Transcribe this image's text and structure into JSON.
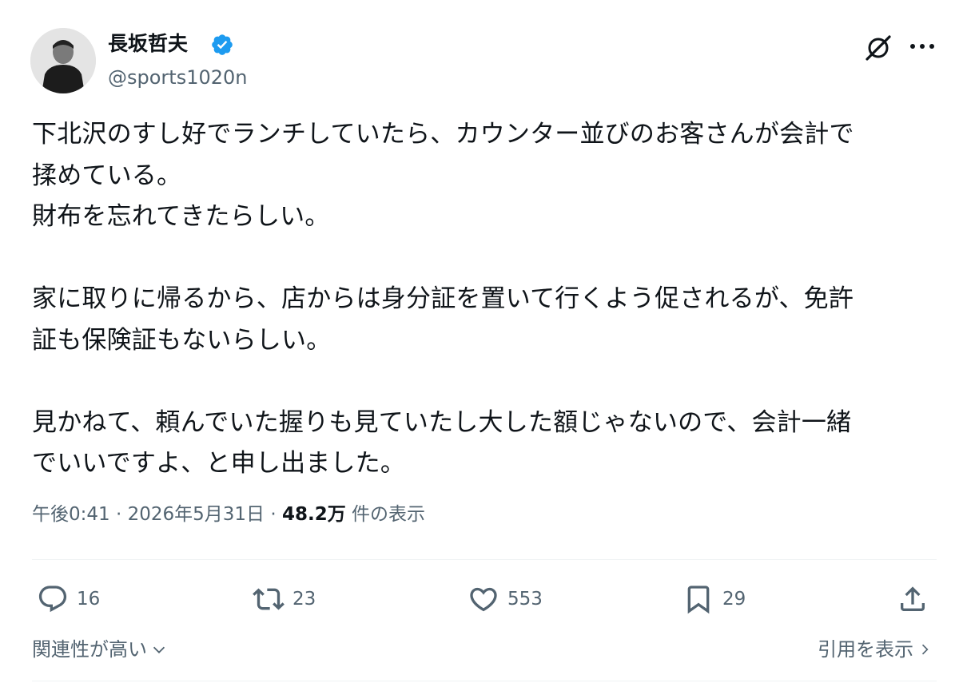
{
  "author": {
    "name": "長坂哲夫",
    "handle": "@sports1020n",
    "verified": true
  },
  "colors": {
    "verified_badge": "#1d9bf0",
    "text_primary": "#0f1419",
    "text_secondary": "#536471"
  },
  "tweet": {
    "text": "下北沢のすし好でランチしていたら、カウンター並びのお客さんが会計で\n揉めている。\n財布を忘れてきたらしい。\n\n家に取りに帰るから、店からは身分証を置いて行くよう促されるが、免許\n証も保険証もないらしい。\n\n見かねて、頼んでいた握りも見ていたし大した額じゃないので、会計一緒\nでいいですよ、と申し出ました。"
  },
  "meta": {
    "time": "午後0:41",
    "separator": "·",
    "date": "2026年5月31日",
    "views_count": "48.2万",
    "views_label": "件の表示"
  },
  "actions": {
    "replies": "16",
    "reposts": "23",
    "likes": "553",
    "bookmarks": "29"
  },
  "footer": {
    "sort_label": "関連性が高い",
    "quotes_label": "引用を表示"
  },
  "icons": {
    "grok": "grok-icon",
    "more": "more-icon",
    "reply": "reply-icon",
    "repost": "repost-icon",
    "like": "heart-icon",
    "bookmark": "bookmark-icon",
    "share": "share-icon"
  }
}
